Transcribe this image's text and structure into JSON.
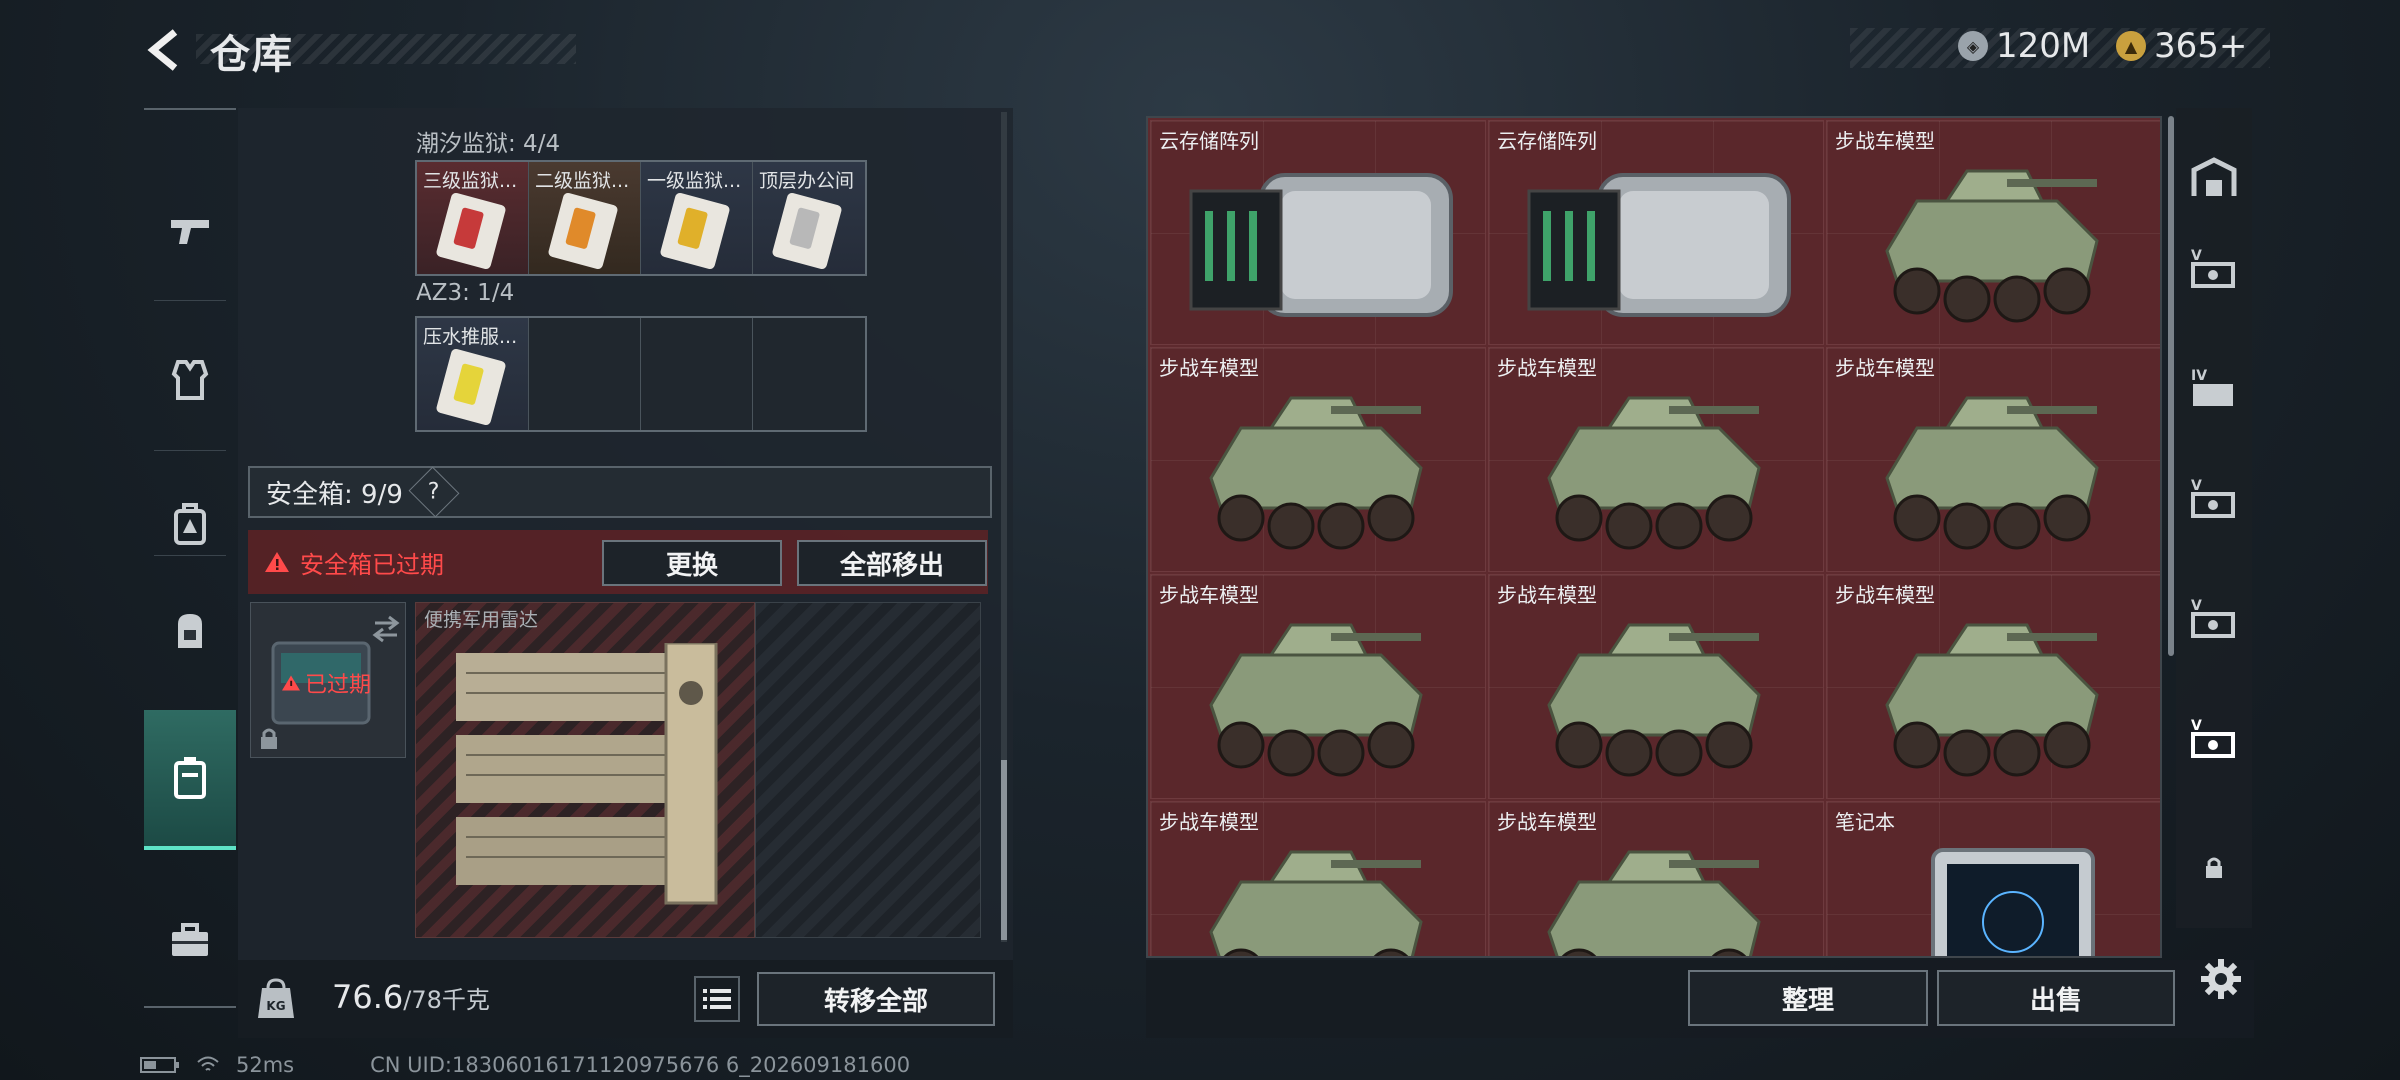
{
  "header": {
    "title": "仓库",
    "currency1": "120M",
    "currency2": "365+"
  },
  "left_nav": {
    "items": [
      "weapon-icon",
      "armor-vest-icon",
      "chest-rig-icon",
      "backpack-icon",
      "safe-box-icon",
      "toolbox-icon"
    ],
    "active": "safe-box-icon"
  },
  "container": {
    "section1_label": "潮汐监狱: 4/4",
    "section1_items": [
      "三级监狱...",
      "二级监狱...",
      "一级监狱...",
      "顶层办公间"
    ],
    "section2_label": "AZ3: 1/4",
    "section2_items": [
      "压水推服..."
    ]
  },
  "safe_box": {
    "label": "安全箱: 9/9",
    "help": "?",
    "expired_notice": "安全箱已过期",
    "replace_button": "更换",
    "remove_all_button": "全部移出",
    "case_status": "已过期",
    "item_name": "便携军用雷达"
  },
  "weight": {
    "current": "76.6",
    "max": "/78千克",
    "badge": "KG"
  },
  "transfer_all_button": "转移全部",
  "stash": {
    "items": [
      "云存储阵列",
      "云存储阵列",
      "步战车模型",
      "步战车模型",
      "步战车模型",
      "步战车模型",
      "步战车模型",
      "步战车模型",
      "步战车模型",
      "步战车模型",
      "步战车模型",
      "笔记本"
    ],
    "sort_button": "整理",
    "sell_button": "出售"
  },
  "right_nav": {
    "items": [
      "cargo-icon",
      "storage-v-icon",
      "storage-iv-icon",
      "storage-v-icon",
      "storage-v-icon",
      "storage-v-icon",
      "lock-icon"
    ]
  },
  "status": {
    "ping": "52ms",
    "uid": "CN UID:18306016171120975676 6_202609181600"
  },
  "colors": {
    "accent": "#5ee3c7",
    "warning": "#ff4a4a",
    "stash_bg": "#5a272b"
  }
}
